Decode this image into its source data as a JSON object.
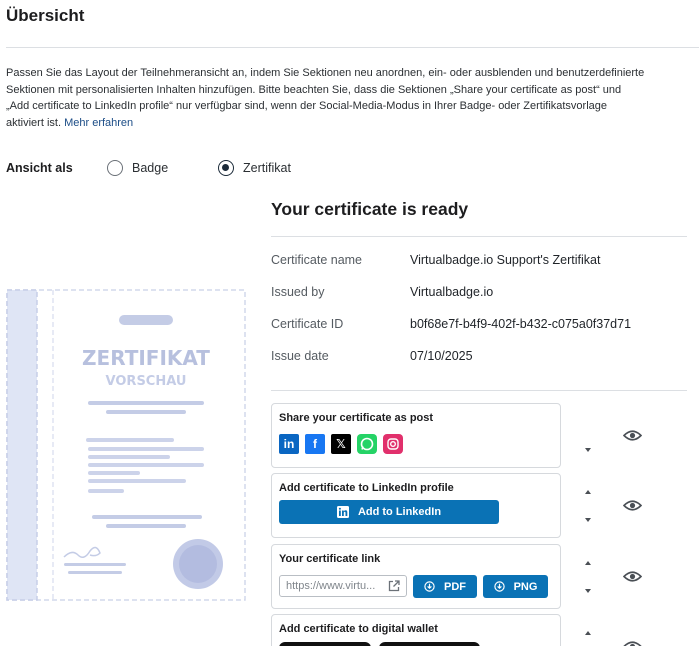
{
  "header": {
    "title": "Übersicht"
  },
  "intro": {
    "text": "Passen Sie das Layout der Teilnehmeransicht an, indem Sie Sektionen neu anordnen, ein- oder ausblenden und benutzerdefinierte Sektionen mit personalisierten Inhalten hinzufügen. Bitte beachten Sie, dass die Sektionen „Share your certificate as post“ und „Add certificate to LinkedIn profile“ nur verfügbar sind, wenn der Social-Media-Modus in Ihrer Badge- oder Zertifikatsvorlage aktiviert ist. ",
    "link": "Mehr erfahren"
  },
  "view_as": {
    "label": "Ansicht als",
    "options": [
      "Badge",
      "Zertifikat"
    ],
    "selected": "Zertifikat"
  },
  "preview": {
    "line1": "ZERTIFIKAT",
    "line2": "VORSCHAU"
  },
  "certificate": {
    "title": "Your certificate is ready",
    "fields": [
      {
        "label": "Certificate name",
        "value": "Virtualbadge.io Support's Zertifikat"
      },
      {
        "label": "Issued by",
        "value": "Virtualbadge.io"
      },
      {
        "label": "Certificate ID",
        "value": "b0f68e7f-b4f9-402f-b432-c075a0f37d71"
      },
      {
        "label": "Issue date",
        "value": "07/10/2025"
      }
    ]
  },
  "sections": {
    "share": {
      "title": "Share your certificate as post",
      "icons": [
        "linkedin-icon",
        "facebook-icon",
        "x-icon",
        "whatsapp-icon",
        "instagram-icon"
      ]
    },
    "linkedin": {
      "title": "Add certificate to LinkedIn profile",
      "button": "Add to LinkedIn"
    },
    "link": {
      "title": "Your certificate link",
      "placeholder": "https://www.virtu...",
      "pdf": "PDF",
      "png": "PNG"
    },
    "wallet": {
      "title": "Add certificate to digital wallet"
    }
  },
  "colors": {
    "accent": "#0a72b5",
    "linkedin": "#0a66c2",
    "facebook": "#1877f2",
    "x": "#000000",
    "whatsapp": "#25d366",
    "instagram": "#e1306c",
    "preview_ink": "#b7c0de"
  }
}
